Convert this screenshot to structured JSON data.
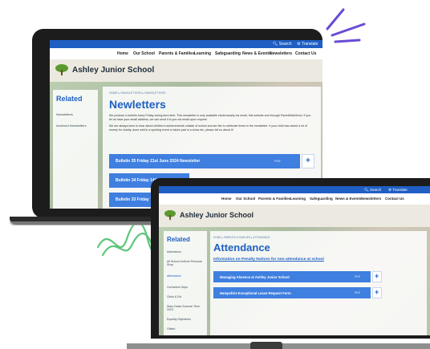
{
  "colors": {
    "brand_blue": "#1f5fc4",
    "button_blue": "#3f7fe0",
    "device": "#1c1c1c",
    "sparks": "#6a4bd6",
    "squiggle": "#5cc77a"
  },
  "laptop": {
    "topbar": {
      "search": "Search",
      "translate": "Translate"
    },
    "nav": [
      "Home",
      "Our School",
      "Parents & Families",
      "Learning",
      "Safeguarding",
      "News & Events",
      "Newsletters",
      "Contact Us"
    ],
    "school_name": "Ashley Junior School",
    "sidebar": {
      "title": "Related",
      "items": [
        "Newsletters",
        "Archived Newsletters"
      ]
    },
    "breadcrumb": [
      "HOME",
      "NEWSLETTERS",
      "NEWSLETTERS"
    ],
    "page_title": "Newletters",
    "para1": "We produce a bulletin every Friday during term time. This newsletter is only available electronically via email, this website and through ParentMail/Arbor. If you let us have your email address, we can send it to you via email upon request.",
    "para2": "We are always keen to hear about children's achievements outside of school and we like to celebrate these in the newsletter. If your child has raised a lot of money for charity, done well in a sporting event or taken part in a show etc, please tell us about it!",
    "bulletins": [
      {
        "label": "Bulletin 35 Friday 21st June 2024 Newsletter",
        "type": "PDF"
      },
      {
        "label": "Bulletin 34 Friday 14th",
        "type": ""
      },
      {
        "label": "Bulletin 33 Friday 7th",
        "type": ""
      }
    ]
  },
  "monitor": {
    "topbar": {
      "search": "Search",
      "translate": "Translate"
    },
    "nav": [
      "Home",
      "Our School",
      "Parents & Families",
      "Learning",
      "Safeguarding",
      "News & Events",
      "Newsletters",
      "Contact Us"
    ],
    "school_name": "Ashley Junior School",
    "sidebar": {
      "title": "Related",
      "items": [
        "Admissions",
        "All School Uniform Personal Shop",
        "Attendance",
        "Curriculum Days",
        "Clubs & Ext",
        "Diary Dates Summer Term 2024",
        "Equality Objectives",
        "Ofsted"
      ]
    },
    "breadcrumb": [
      "HOME",
      "PARENTS & FAMILIES",
      "ATTENDANCE"
    ],
    "page_title": "Attendance",
    "subheading": "Information on Penalty Notices for non-attendance at school",
    "documents": [
      {
        "label": "Managing Absence at Ashley Junior School",
        "type": "PDF"
      },
      {
        "label": "Hampshire Exceptional Leave Request Form",
        "type": "PDF"
      }
    ]
  }
}
